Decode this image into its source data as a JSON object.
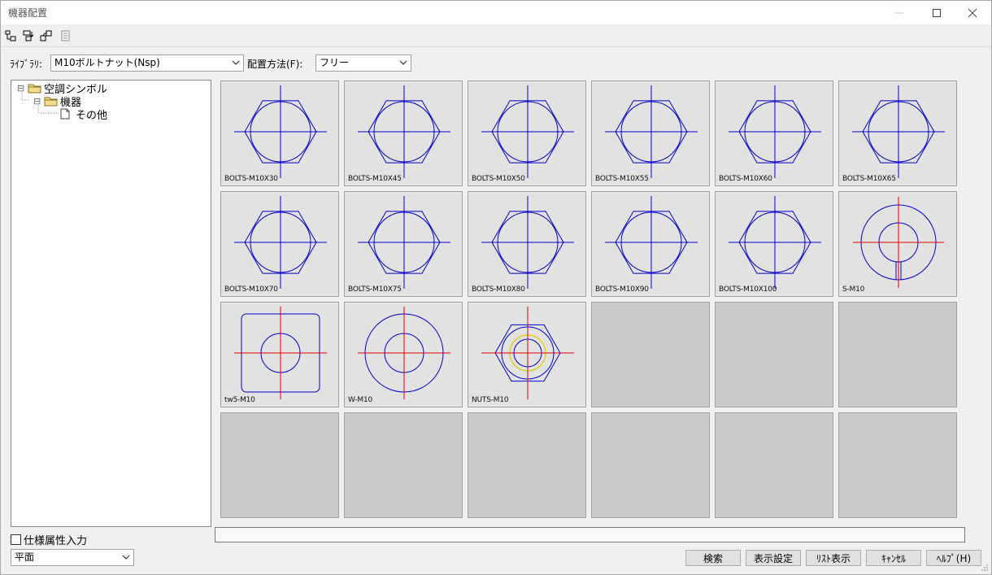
{
  "window": {
    "title": "機器配置"
  },
  "toolbar": {
    "buttons": [
      {
        "icon": "tree-expand-icon"
      },
      {
        "icon": "tree-collapse-icon"
      },
      {
        "icon": "link-icon"
      },
      {
        "icon": "document-icon"
      }
    ]
  },
  "library": {
    "label": "ﾗｲﾌﾞﾗﾘ:",
    "value": "M10ボルトナット(Nsp)"
  },
  "placement": {
    "label": "配置方法(F):",
    "value": "フリー"
  },
  "tree": {
    "items": [
      {
        "label": "空調シンボル",
        "expander": "⊟",
        "icon": "folder-icon"
      },
      {
        "label": "機器",
        "expander": "⊟",
        "icon": "folder-icon"
      },
      {
        "label": "その他",
        "expander": "",
        "icon": "file-icon"
      }
    ]
  },
  "symbols": [
    {
      "name": "BOLTS-M10X30",
      "kind": "bolt"
    },
    {
      "name": "BOLTS-M10X45",
      "kind": "bolt"
    },
    {
      "name": "BOLTS-M10X50",
      "kind": "bolt"
    },
    {
      "name": "BOLTS-M10X55",
      "kind": "bolt"
    },
    {
      "name": "BOLTS-M10X60",
      "kind": "bolt"
    },
    {
      "name": "BOLTS-M10X65",
      "kind": "bolt"
    },
    {
      "name": "BOLTS-M10X70",
      "kind": "bolt"
    },
    {
      "name": "BOLTS-M10X75",
      "kind": "bolt"
    },
    {
      "name": "BOLTS-M10X80",
      "kind": "bolt"
    },
    {
      "name": "BOLTS-M10X90",
      "kind": "bolt"
    },
    {
      "name": "BOLTS-M10X100",
      "kind": "bolt"
    },
    {
      "name": "S-M10",
      "kind": "spring-washer"
    },
    {
      "name": "tw5-M10",
      "kind": "square-washer"
    },
    {
      "name": "W-M10",
      "kind": "washer"
    },
    {
      "name": "NUTS-M10",
      "kind": "nut"
    }
  ],
  "grid": {
    "total_cells": 24
  },
  "spec_checkbox": {
    "label": "仕様属性入力",
    "checked": false
  },
  "view_select": {
    "value": "平面"
  },
  "buttons": {
    "search": "検索",
    "display_settings": "表示設定",
    "list_view": "ﾘｽﾄ表示",
    "cancel": "ｷｬﾝｾﾙ",
    "help": "ﾍﾙﾌﾟ(H)"
  },
  "colors": {
    "symbol_line": "#0000cc",
    "center_line_red": "#e00000",
    "washer_yellow": "#e8c800",
    "cell_bg": "#e2e2e2",
    "empty_cell_bg": "#cacaca"
  }
}
